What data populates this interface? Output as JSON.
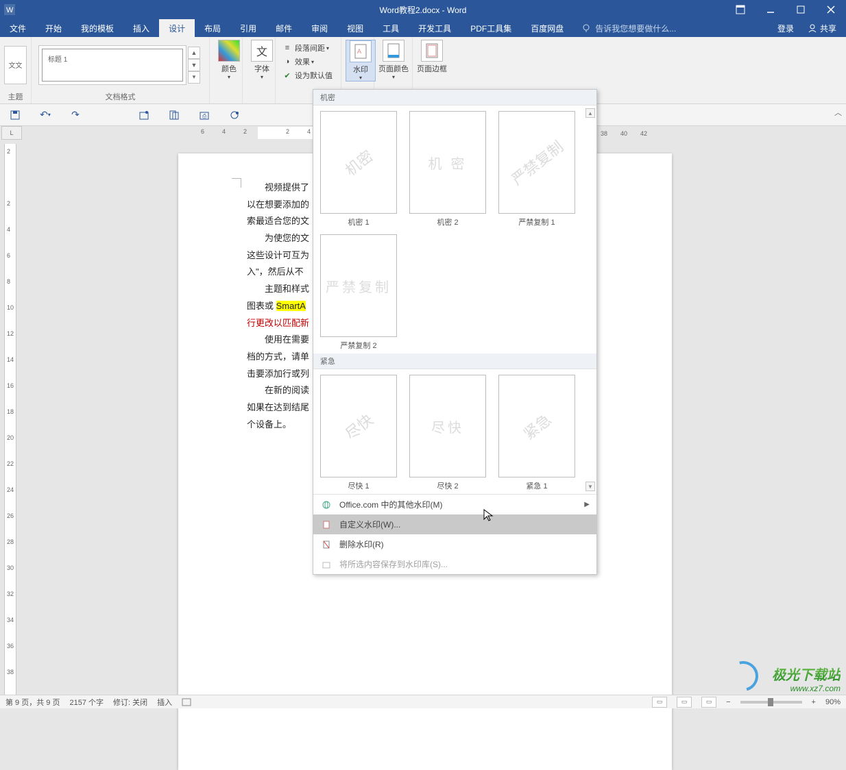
{
  "window": {
    "title": "Word教程2.docx - Word"
  },
  "tabs": {
    "file": "文件",
    "home": "开始",
    "my_templates": "我的模板",
    "insert": "插入",
    "design": "设计",
    "layout": "布局",
    "references": "引用",
    "mailings": "邮件",
    "review": "审阅",
    "view": "视图",
    "tools": "工具",
    "developer": "开发工具",
    "pdf_tools": "PDF工具集",
    "baidu": "百度网盘",
    "tell_me_placeholder": "告诉我您想要做什么...",
    "signin": "登录",
    "share": "共享"
  },
  "ribbon": {
    "theme_small": "文文",
    "theme_label": "主题",
    "style_tiny": "标题 1",
    "doc_format_label": "文档格式",
    "colors": "颜色",
    "fonts": "字体",
    "para_spacing": "段落间距",
    "effects": "效果",
    "set_default": "设为默认值",
    "watermark": "水印",
    "page_color": "页面颜色",
    "page_borders": "页面边框"
  },
  "ruler": {
    "corner": "L"
  },
  "document": {
    "lines": [
      "视频提供了",
      "以在想要添加的",
      "索最适合您的文",
      "为使您的文",
      "这些设计可互为",
      "入\"，然后从不",
      "主题和样式",
      "图表或 ",
      "行更改以匹配新",
      "使用在需要",
      "档的方式，请单",
      "击要添加行或列",
      "在新的阅读",
      "如果在达到结尾",
      "个设备上。"
    ],
    "smartart": "SmartA"
  },
  "watermark_panel": {
    "section1": "机密",
    "section2": "紧急",
    "items1": [
      {
        "text": "机密",
        "caption": "机密 1",
        "diag": true
      },
      {
        "text": "机 密",
        "caption": "机密 2",
        "diag": false
      },
      {
        "text": "严禁复制",
        "caption": "严禁复制 1",
        "diag": true
      },
      {
        "text": "严禁复制",
        "caption": "严禁复制 2",
        "diag": false
      }
    ],
    "items2": [
      {
        "text": "尽快",
        "caption": "尽快 1",
        "diag": true
      },
      {
        "text": "尽快",
        "caption": "尽快 2",
        "diag": false
      },
      {
        "text": "紧急",
        "caption": "紧急 1",
        "diag": true
      }
    ],
    "menu_office": "Office.com 中的其他水印(M)",
    "menu_custom": "自定义水印(W)...",
    "menu_remove": "删除水印(R)",
    "menu_save": "将所选内容保存到水印库(S)..."
  },
  "status": {
    "page": "第 9 页，共 9 页",
    "words": "2157 个字",
    "track": "修订: 关闭",
    "insert": "插入",
    "lang_icon": "",
    "zoom": "90%"
  },
  "ruler_right": [
    "38",
    "40",
    "42"
  ],
  "brand": {
    "name": "极光下载站",
    "url": "www.xz7.com"
  },
  "vruler": [
    "2",
    "",
    "2",
    "4",
    "6",
    "8",
    "10",
    "12",
    "14",
    "16",
    "18",
    "20",
    "22",
    "24",
    "26",
    "28",
    "30",
    "32",
    "34",
    "36",
    "38"
  ],
  "hruler": [
    "6",
    "4",
    "2",
    "",
    "2",
    "4"
  ]
}
